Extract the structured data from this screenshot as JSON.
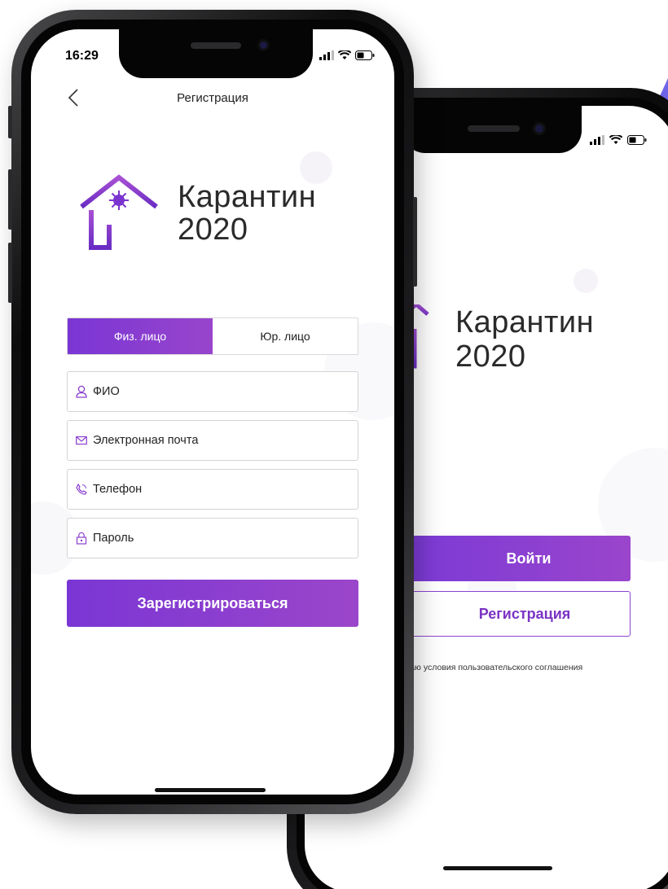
{
  "colors": {
    "accent": "#8a3fd0",
    "accent_start": "#7a36d4",
    "accent_end": "#9b46ca",
    "text": "#222222",
    "border": "#d4d4d4"
  },
  "front_screen": {
    "status_time": "16:29",
    "status_icons": [
      "signal-icon",
      "wifi-icon",
      "battery-icon"
    ],
    "header_title": "Регистрация",
    "brand": {
      "line1": "Карантин",
      "line2": "2020"
    },
    "tabs": [
      {
        "label": "Физ. лицо",
        "active": true
      },
      {
        "label": "Юр. лицо",
        "active": false
      }
    ],
    "fields": [
      {
        "label": "ФИО",
        "icon": "user-icon"
      },
      {
        "label": "Электронная почта",
        "icon": "mail-icon"
      },
      {
        "label": "Телефон",
        "icon": "phone-icon"
      },
      {
        "label": "Пароль",
        "icon": "lock-icon"
      }
    ],
    "submit_label": "Зарегистрироваться"
  },
  "back_screen": {
    "status_icons": [
      "signal-icon",
      "wifi-icon",
      "battery-icon"
    ],
    "brand": {
      "line1": "Карантин",
      "line2": "2020"
    },
    "login_label": "Войти",
    "register_label": "Регистрация",
    "terms_text": "маю условия пользовательского соглашения"
  }
}
